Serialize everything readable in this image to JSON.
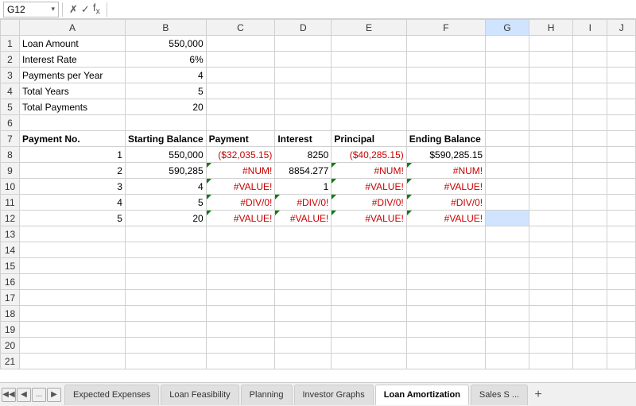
{
  "formulaBar": {
    "cellRef": "G12",
    "formula": ""
  },
  "columns": [
    "",
    "A",
    "B",
    "C",
    "D",
    "E",
    "F",
    "G",
    "H",
    "I",
    "J"
  ],
  "rows": [
    {
      "rowNum": "1",
      "cells": {
        "A": "Loan Amount",
        "B": "550,000",
        "C": "",
        "D": "",
        "E": "",
        "F": "",
        "G": "",
        "H": "",
        "I": "",
        "J": ""
      }
    },
    {
      "rowNum": "2",
      "cells": {
        "A": "Interest Rate",
        "B": "6%",
        "C": "",
        "D": "",
        "E": "",
        "F": "",
        "G": "",
        "H": "",
        "I": "",
        "J": ""
      }
    },
    {
      "rowNum": "3",
      "cells": {
        "A": "Payments per Year",
        "B": "4",
        "C": "",
        "D": "",
        "E": "",
        "F": "",
        "G": "",
        "H": "",
        "I": "",
        "J": ""
      }
    },
    {
      "rowNum": "4",
      "cells": {
        "A": "Total Years",
        "B": "5",
        "C": "",
        "D": "",
        "E": "",
        "F": "",
        "G": "",
        "H": "",
        "I": "",
        "J": ""
      }
    },
    {
      "rowNum": "5",
      "cells": {
        "A": "Total Payments",
        "B": "20",
        "C": "",
        "D": "",
        "E": "",
        "F": "",
        "G": "",
        "H": "",
        "I": "",
        "J": ""
      }
    },
    {
      "rowNum": "6",
      "cells": {
        "A": "",
        "B": "",
        "C": "",
        "D": "",
        "E": "",
        "F": "",
        "G": "",
        "H": "",
        "I": "",
        "J": ""
      }
    },
    {
      "rowNum": "7",
      "cells": {
        "A": "Payment No.",
        "B": "Starting Balance",
        "C": "Payment",
        "D": "Interest",
        "E": "Principal",
        "F": "Ending Balance",
        "G": "",
        "H": "",
        "I": "",
        "J": ""
      }
    },
    {
      "rowNum": "8",
      "cells": {
        "A": "1",
        "B": "550,000",
        "C": "($32,035.15)",
        "D": "8250",
        "E": "($40,285.15)",
        "F": "$590,285.15",
        "G": "",
        "H": "",
        "I": "",
        "J": ""
      }
    },
    {
      "rowNum": "9",
      "cells": {
        "A": "2",
        "B": "590,285",
        "C": "#NUM!",
        "D": "8854.277",
        "E": "#NUM!",
        "F": "#NUM!",
        "G": "",
        "H": "",
        "I": "",
        "J": ""
      }
    },
    {
      "rowNum": "10",
      "cells": {
        "A": "3",
        "B": "4",
        "C": "#VALUE!",
        "D": "1",
        "E": "#VALUE!",
        "F": "#VALUE!",
        "G": "",
        "H": "",
        "I": "",
        "J": ""
      }
    },
    {
      "rowNum": "11",
      "cells": {
        "A": "4",
        "B": "5",
        "C": "#DIV/0!",
        "D": "#DIV/0!",
        "E": "#DIV/0!",
        "F": "#DIV/0!",
        "G": "",
        "H": "",
        "I": "",
        "J": ""
      }
    },
    {
      "rowNum": "12",
      "cells": {
        "A": "5",
        "B": "20",
        "C": "#VALUE!",
        "D": "#VALUE!",
        "E": "#VALUE!",
        "F": "#VALUE!",
        "G": "",
        "H": "",
        "I": "",
        "J": ""
      }
    },
    {
      "rowNum": "13",
      "cells": {
        "A": "",
        "B": "",
        "C": "",
        "D": "",
        "E": "",
        "F": "",
        "G": "",
        "H": "",
        "I": "",
        "J": ""
      }
    },
    {
      "rowNum": "14",
      "cells": {
        "A": "",
        "B": "",
        "C": "",
        "D": "",
        "E": "",
        "F": "",
        "G": "",
        "H": "",
        "I": "",
        "J": ""
      }
    },
    {
      "rowNum": "15",
      "cells": {
        "A": "",
        "B": "",
        "C": "",
        "D": "",
        "E": "",
        "F": "",
        "G": "",
        "H": "",
        "I": "",
        "J": ""
      }
    },
    {
      "rowNum": "16",
      "cells": {
        "A": "",
        "B": "",
        "C": "",
        "D": "",
        "E": "",
        "F": "",
        "G": "",
        "H": "",
        "I": "",
        "J": ""
      }
    },
    {
      "rowNum": "17",
      "cells": {
        "A": "",
        "B": "",
        "C": "",
        "D": "",
        "E": "",
        "F": "",
        "G": "",
        "H": "",
        "I": "",
        "J": ""
      }
    },
    {
      "rowNum": "18",
      "cells": {
        "A": "",
        "B": "",
        "C": "",
        "D": "",
        "E": "",
        "F": "",
        "G": "",
        "H": "",
        "I": "",
        "J": ""
      }
    },
    {
      "rowNum": "19",
      "cells": {
        "A": "",
        "B": "",
        "C": "",
        "D": "",
        "E": "",
        "F": "",
        "G": "",
        "H": "",
        "I": "",
        "J": ""
      }
    },
    {
      "rowNum": "20",
      "cells": {
        "A": "",
        "B": "",
        "C": "",
        "D": "",
        "E": "",
        "F": "",
        "G": "",
        "H": "",
        "I": "",
        "J": ""
      }
    },
    {
      "rowNum": "21",
      "cells": {
        "A": "",
        "B": "",
        "C": "",
        "D": "",
        "E": "",
        "F": "",
        "G": "",
        "H": "",
        "I": "",
        "J": ""
      }
    }
  ],
  "tabs": [
    {
      "id": "expected-expenses",
      "label": "Expected Expenses",
      "active": false
    },
    {
      "id": "loan-feasibility",
      "label": "Loan Feasibility",
      "active": false
    },
    {
      "id": "planning",
      "label": "Planning",
      "active": false
    },
    {
      "id": "investor-graphs",
      "label": "Investor Graphs",
      "active": false
    },
    {
      "id": "loan-amortization",
      "label": "Loan Amortization",
      "active": true
    },
    {
      "id": "sales",
      "label": "Sales S ...",
      "active": false
    }
  ],
  "tabAddLabel": "+",
  "tabNavLabels": {
    "first": "◀◀",
    "prev": "◀",
    "next": "▶",
    "dots": "..."
  }
}
